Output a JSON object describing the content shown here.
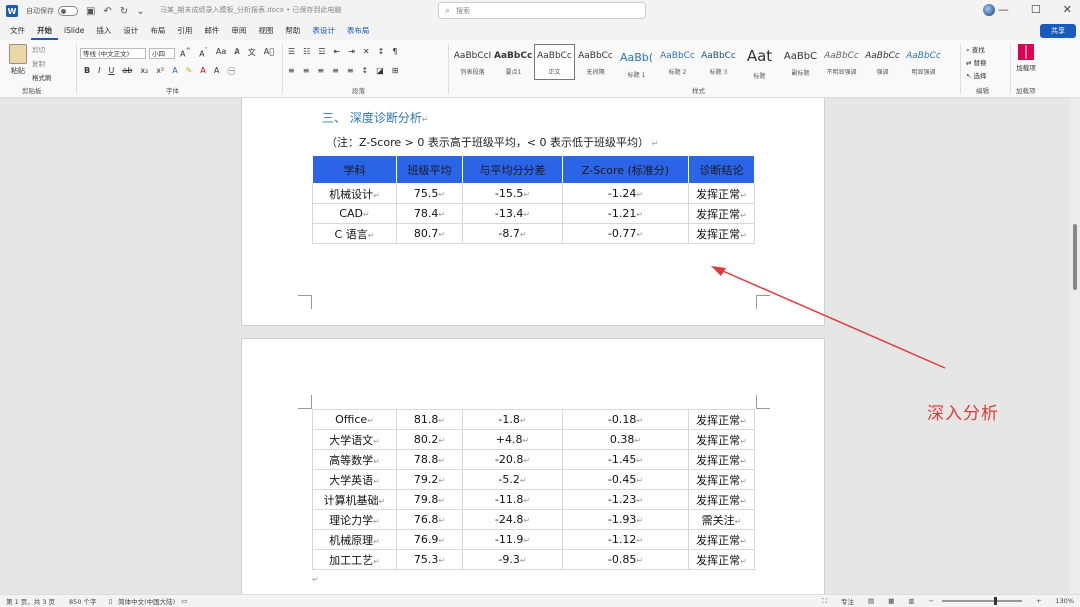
{
  "titlebar": {
    "autosave": "自动保存",
    "doc_title": "马某_期末成绩录入模板_分析报表.docx • 已保存到此电脑",
    "search_placeholder": "搜索"
  },
  "menu": {
    "tabs": [
      "文件",
      "开始",
      "iSlide",
      "插入",
      "设计",
      "布局",
      "引用",
      "邮件",
      "审阅",
      "视图",
      "帮助",
      "表设计",
      "表布局"
    ],
    "share": "共享"
  },
  "ribbon": {
    "paste": "粘贴",
    "cut": "剪切",
    "copy": "复制",
    "format_painter": "格式刷",
    "clipboard_label": "剪贴板",
    "font_name": "等线 (中文正文)",
    "font_size": "小四",
    "font_label": "字体",
    "paragraph_label": "段落",
    "styles": [
      {
        "sample": "AaBbCcI",
        "name": "列表段落"
      },
      {
        "sample": "AaBbCcI",
        "name": "要点1"
      },
      {
        "sample": "AaBbCc",
        "name": "正文"
      },
      {
        "sample": "AaBbCc",
        "name": "无间隔"
      },
      {
        "sample": "AaBb(",
        "name": "标题 1"
      },
      {
        "sample": "AaBbCc",
        "name": "标题 2"
      },
      {
        "sample": "AaBbCc",
        "name": "标题 3"
      },
      {
        "sample": "Aat",
        "name": "标题"
      },
      {
        "sample": "AaBbC",
        "name": "副标题"
      },
      {
        "sample": "AaBbCc",
        "name": "不明显强调"
      },
      {
        "sample": "AaBbCc",
        "name": "强调"
      },
      {
        "sample": "AaBbCc",
        "name": "明显强调"
      }
    ],
    "styles_label": "样式",
    "find": "查找",
    "replace": "替换",
    "select": "选择",
    "editing_label": "编辑",
    "addin": "加载项",
    "addin_label": "加载项"
  },
  "document": {
    "heading": "三、 深度诊断分析",
    "note": "（注：Z-Score > 0 表示高于班级平均，< 0 表示低于班级平均）",
    "table_headers": [
      "学科",
      "班级平均",
      "与平均分分差",
      "Z-Score (标准分)",
      "诊断结论"
    ],
    "rows_page1": [
      [
        "机械设计",
        "75.5",
        "-15.5",
        "-1.24",
        "发挥正常"
      ],
      [
        "CAD",
        "78.4",
        "-13.4",
        "-1.21",
        "发挥正常"
      ],
      [
        "C 语言",
        "80.7",
        "-8.7",
        "-0.77",
        "发挥正常"
      ]
    ],
    "rows_page2": [
      [
        "Office",
        "81.8",
        "-1.8",
        "-0.18",
        "发挥正常"
      ],
      [
        "大学语文",
        "80.2",
        "+4.8",
        "0.38",
        "发挥正常"
      ],
      [
        "高等数学",
        "78.8",
        "-20.8",
        "-1.45",
        "发挥正常"
      ],
      [
        "大学英语",
        "79.2",
        "-5.2",
        "-0.45",
        "发挥正常"
      ],
      [
        "计算机基础",
        "79.8",
        "-11.8",
        "-1.23",
        "发挥正常"
      ],
      [
        "理论力学",
        "76.8",
        "-24.8",
        "-1.93",
        "需关注"
      ],
      [
        "机械原理",
        "76.9",
        "-11.9",
        "-1.12",
        "发挥正常"
      ],
      [
        "加工工艺",
        "75.3",
        "-9.3",
        "-0.85",
        "发挥正常"
      ]
    ]
  },
  "annotation": {
    "text": "深入分析",
    "color": "#e03a3a"
  },
  "status": {
    "page": "第 1 页，共 3 页",
    "words": "850 个字",
    "language": "简体中文(中国大陆)",
    "focus": "专注",
    "zoom": "130%"
  },
  "colors": {
    "header_fill": "#2b64e7",
    "heading": "#2e74b5",
    "accent": "#185abd"
  }
}
